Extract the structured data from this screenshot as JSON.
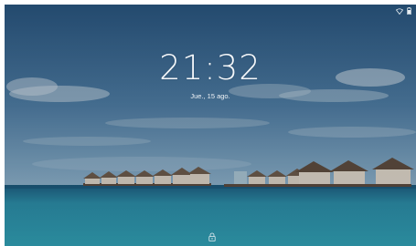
{
  "lockscreen": {
    "time": "21:32",
    "date": "Jue., 15 ago."
  },
  "status_bar": {
    "icons": [
      "wifi-icon",
      "battery-icon"
    ]
  },
  "bottom": {
    "icon": "lock-icon"
  },
  "colors": {
    "sky_top": "#2f5f8c",
    "sky_bottom": "#8fb4cf",
    "sea_deep": "#1f6f8e",
    "sea_shallow": "#3aa3b4",
    "text": "#f4f7fa"
  }
}
